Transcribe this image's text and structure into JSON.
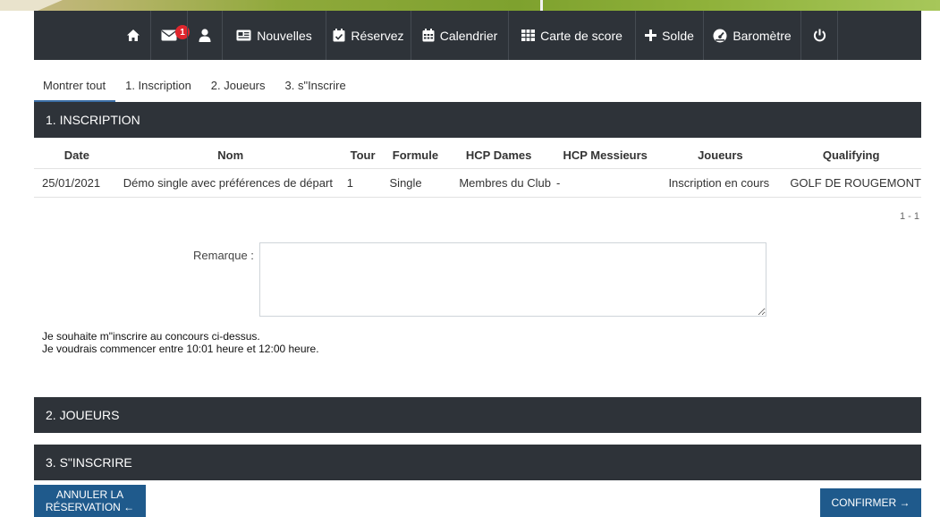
{
  "nav": {
    "badge_count": "1",
    "news": "Nouvelles",
    "reserve": "Réservez",
    "calendar": "Calendrier",
    "scorecard": "Carte de score",
    "balance": "Solde",
    "barometer": "Baromètre"
  },
  "tabs": [
    "Montrer tout",
    "1. Inscription",
    "2. Joueurs",
    "3. s\"Inscrire"
  ],
  "sections": {
    "inscription": "1. INSCRIPTION",
    "players": "2. JOUEURS",
    "register": "3. S\"INSCRIRE"
  },
  "table": {
    "headers": [
      "Date",
      "Nom",
      "Tour",
      "Formule",
      "HCP Dames",
      "HCP Messieurs",
      "Joueurs",
      "Qualifying"
    ],
    "row": [
      "25/01/2021",
      "Démo single avec préférences de départ",
      "1",
      "Single",
      "Membres du Club",
      "-",
      "Inscription en cours",
      "GOLF DE ROUGEMONT"
    ]
  },
  "pager": "1 - 1",
  "remark_label": "Remarque :",
  "remark_value": "",
  "messages": [
    "Je souhaite m\"inscrire au concours ci-dessus.",
    "Je voudrais commencer entre 10:01 heure et 12:00 heure."
  ],
  "buttons": {
    "cancel_line1": "ANNULER LA",
    "cancel_line2": "RÉSERVATION ←",
    "confirm": "CONFIRMER →"
  }
}
